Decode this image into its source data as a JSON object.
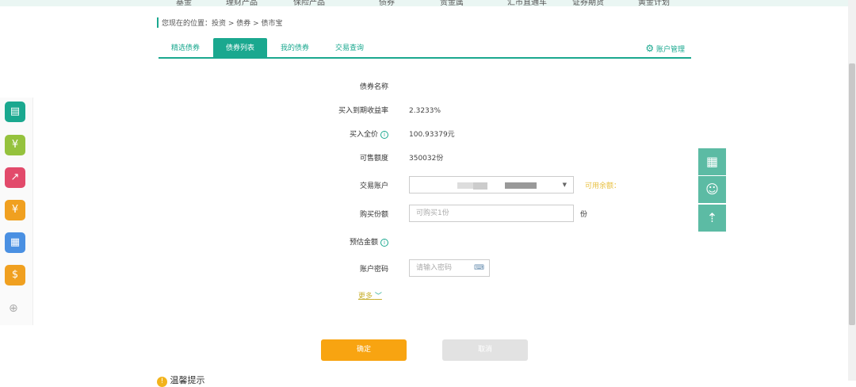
{
  "topnav": [
    "基金",
    "理财产品",
    "保险产品",
    "债券",
    "贵金属",
    "汇市直通车",
    "证券期货",
    "黄金计划"
  ],
  "breadcrumb": "您现在的位置：投资 > 债券 > 债市宝",
  "tabs": [
    "精选债券",
    "债券列表",
    "我的债券",
    "交易查询"
  ],
  "account_manage": "账户管理",
  "form": {
    "bond_name_label": "债券名称",
    "yield_label": "买入到期收益率",
    "yield_value": "2.3233%",
    "price_label": "买入全价",
    "price_value": "100.93379元",
    "quota_label": "可售额度",
    "quota_value": "350032份",
    "account_label": "交易账户",
    "available_label": "可用余额：",
    "amount_label": "购买份额",
    "amount_placeholder": "可购买1份",
    "amount_unit": "份",
    "estimate_label": "预估金额",
    "password_label": "账户密码",
    "password_placeholder": "请输入密码",
    "more": "更多"
  },
  "buttons": {
    "confirm": "确定",
    "cancel": "取消"
  },
  "tips_title": "温馨提示",
  "colors": {
    "accent": "#1aa88f",
    "confirm": "#f8a411"
  }
}
